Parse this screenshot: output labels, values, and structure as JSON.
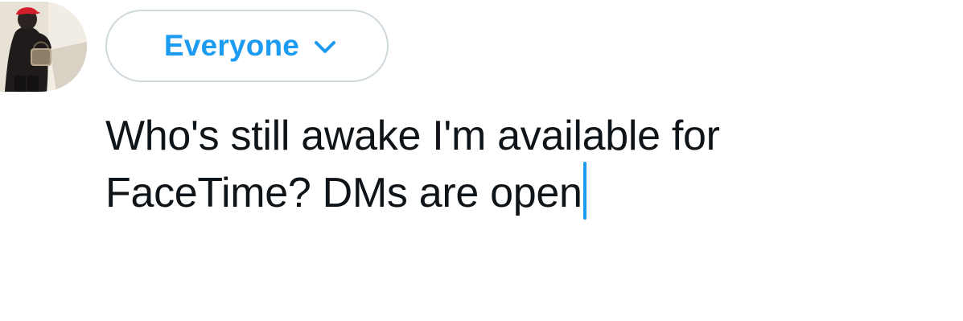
{
  "composer": {
    "audience": {
      "label": "Everyone",
      "icon": "chevron-down-icon",
      "color": "#1d9bf0"
    },
    "avatar": {
      "icon": "user-avatar"
    },
    "text": {
      "line1": "Who's still awake I'm available for",
      "line2": "FaceTime? DMs are open"
    },
    "colors": {
      "text": "#0f1419",
      "accent": "#1d9bf0",
      "border": "#cfd9de"
    }
  }
}
